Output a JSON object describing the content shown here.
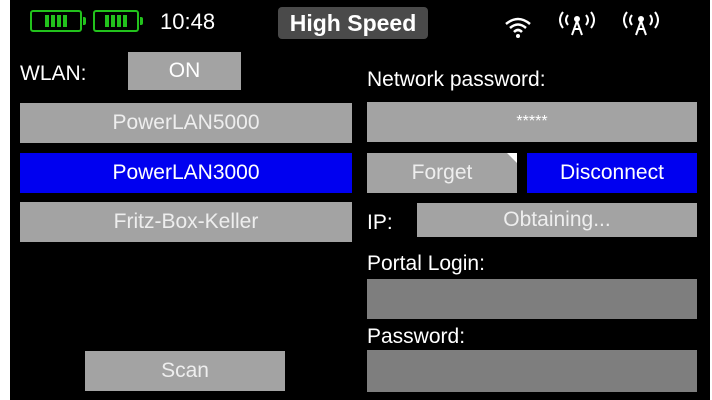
{
  "status_bar": {
    "time": "10:48",
    "mode_label": "High Speed",
    "icons": [
      "battery-icon",
      "battery-icon",
      "wifi-icon",
      "antenna-icon",
      "antenna-icon"
    ]
  },
  "wlan": {
    "label": "WLAN:",
    "toggle_value": "ON"
  },
  "networks": [
    {
      "name": "PowerLAN5000",
      "selected": false
    },
    {
      "name": "PowerLAN3000",
      "selected": true
    },
    {
      "name": "Fritz-Box-Keller",
      "selected": false
    }
  ],
  "scan_label": "Scan",
  "password_section": {
    "label": "Network password:",
    "value": "*****"
  },
  "actions": {
    "forget_label": "Forget",
    "disconnect_label": "Disconnect"
  },
  "ip": {
    "label": "IP:",
    "value": "Obtaining..."
  },
  "portal": {
    "login_label": "Portal Login:",
    "login_value": "",
    "password_label": "Password:",
    "password_value": ""
  },
  "colors": {
    "background": "#000000",
    "button_gray": "#a3a3a3",
    "field_gray": "#7e7e7e",
    "selected_blue": "#0000f0",
    "battery_green": "#22c21c"
  }
}
